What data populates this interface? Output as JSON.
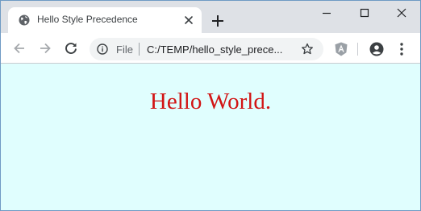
{
  "tab": {
    "title": "Hello Style Precedence",
    "favicon": "globe-icon",
    "close_icon": "close-icon"
  },
  "window_controls": {
    "minimize_icon": "minimize-icon",
    "maximize_icon": "maximize-icon",
    "close_icon": "close-icon"
  },
  "toolbar": {
    "back_icon": "back-arrow-icon",
    "forward_icon": "forward-arrow-icon",
    "reload_icon": "reload-icon",
    "omnibox": {
      "info_icon": "info-icon",
      "scheme_label": "File",
      "url": "C:/TEMP/hello_style_prece...",
      "star_icon": "star-icon"
    },
    "extension_icon": "angular-extension-icon",
    "profile_icon": "profile-icon",
    "menu_icon": "more-vert-icon"
  },
  "page": {
    "heading": "Hello World.",
    "heading_color": "#d21414",
    "background_color": "#e0fefe"
  }
}
